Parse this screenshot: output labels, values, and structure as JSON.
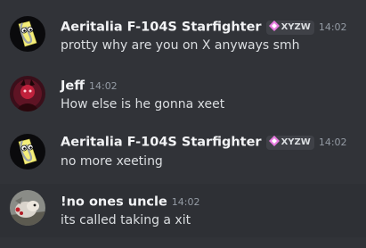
{
  "messages": [
    {
      "author": "Aeritalia F-104S Starfighter",
      "tag": "XYZW",
      "time": "14:02",
      "text": "protty why are you on X anyways smh",
      "avatar": "paperclip-avatar"
    },
    {
      "author": "Jeff",
      "time": "14:02",
      "text": "How else is he gonna xeet",
      "avatar": "dark-red-figure-avatar"
    },
    {
      "author": "Aeritalia F-104S Starfighter",
      "tag": "XYZW",
      "time": "14:02",
      "text": "no more xeeting",
      "avatar": "paperclip-avatar"
    },
    {
      "author": "!no ones uncle",
      "time": "14:02",
      "text": "its called taking a xit",
      "avatar": "animal-photo-avatar"
    }
  ],
  "colors": {
    "background": "#313338",
    "hover_background": "#2e3035",
    "username": "#f2f3f5",
    "message_text": "#dbdee1",
    "timestamp": "#949ba4",
    "tag_background": "#3f4147",
    "tag_icon": "#e87be0"
  }
}
